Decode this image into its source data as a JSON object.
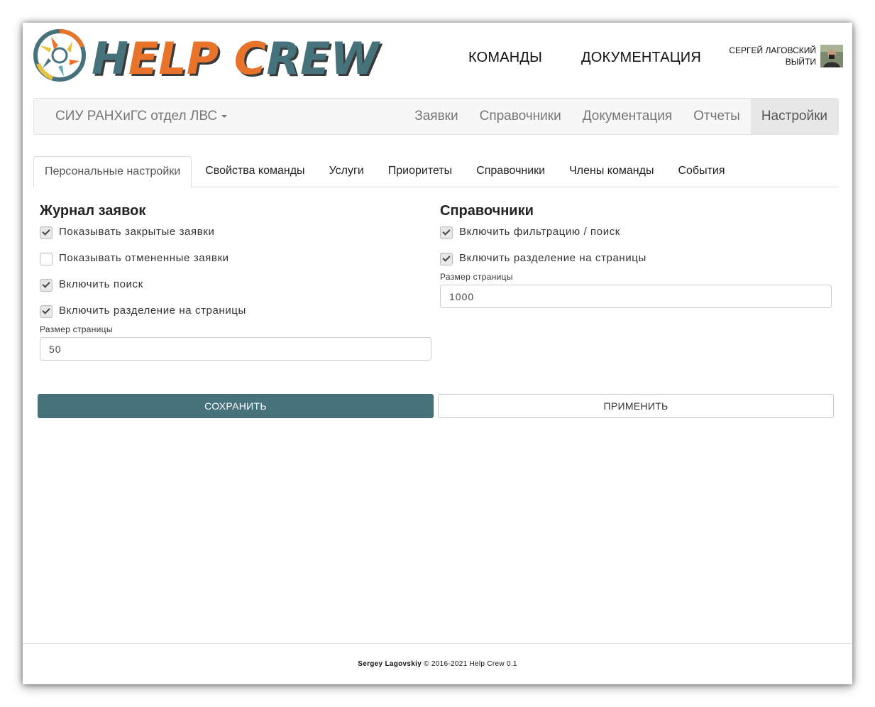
{
  "header": {
    "logo_text": "HELP CREW",
    "nav": [
      "КОМАНДЫ",
      "ДОКУМЕНТАЦИЯ"
    ],
    "user_name": "СЕРГЕЙ ЛАГОВСКИЙ",
    "logout": "ВЫЙТИ"
  },
  "navbar": {
    "brand": "СИУ РАНХиГС отдел ЛВС",
    "links": [
      "Заявки",
      "Справочники",
      "Документация",
      "Отчеты",
      "Настройки"
    ],
    "active": "Настройки"
  },
  "tabs": [
    "Персональные настройки",
    "Свойства команды",
    "Услуги",
    "Приоритеты",
    "Справочники",
    "Члены команды",
    "События"
  ],
  "left": {
    "title": "Журнал заявок",
    "checkboxes": [
      {
        "label": "Показывать закрытые заявки",
        "checked": true
      },
      {
        "label": "Показывать отмененные заявки",
        "checked": false
      },
      {
        "label": "Включить поиск",
        "checked": true
      },
      {
        "label": "Включить разделение на страницы",
        "checked": true
      }
    ],
    "page_size_label": "Размер страницы",
    "page_size": "50"
  },
  "right": {
    "title": "Справочники",
    "checkboxes": [
      {
        "label": "Включить фильтрацию / поиск",
        "checked": true
      },
      {
        "label": "Включить разделение на страницы",
        "checked": true
      }
    ],
    "page_size_label": "Размер страницы",
    "page_size": "1000"
  },
  "buttons": {
    "save": "СОХРАНИТЬ",
    "apply": "ПРИМЕНИТЬ"
  },
  "footer": {
    "author": "Sergey Lagovskiy",
    "copyright": " © 2016-2021  Help Crew 0.1"
  },
  "colors": {
    "primary": "#46727c",
    "logo_orange": "#e8742c",
    "logo_teal": "#46727c"
  }
}
